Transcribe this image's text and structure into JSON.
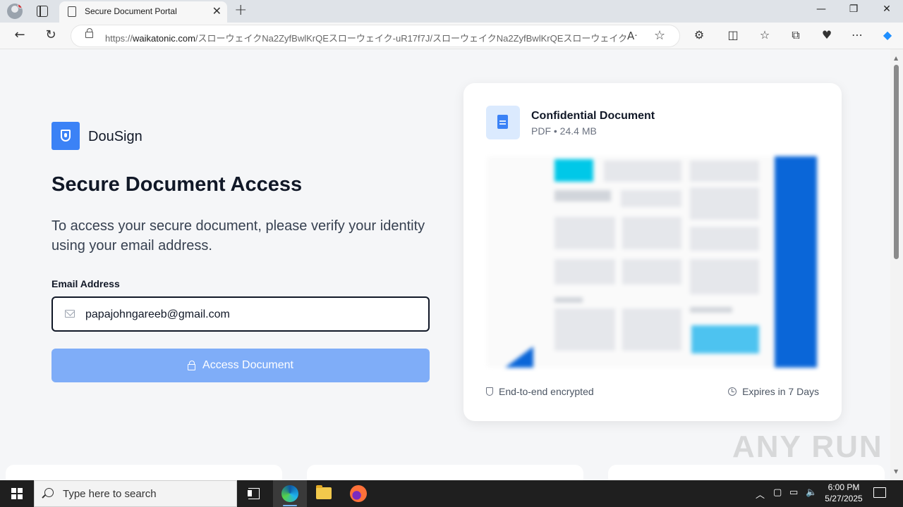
{
  "browser": {
    "tab_title": "Secure Document Portal",
    "url_prefix": "https://",
    "url_domain": "waikatonic.com",
    "url_path": "/スローウェイクNa2ZyfBwlKrQEスローウェイク-uR17f7J/スローウェイクNa2ZyfBwlKrQEスローウェイク-uR17f...",
    "new_tab_label": "+",
    "close_tab_label": "✕"
  },
  "brand": {
    "name": "DouSign",
    "accent": "#3b82f6"
  },
  "main": {
    "heading": "Secure Document Access",
    "description": "To access your secure document, please verify your identity using your email address.",
    "email_label": "Email Address",
    "email_value": "papajohngareeb@gmail.com",
    "button_label": "Access Document",
    "button_color": "#7fadf8"
  },
  "document": {
    "title": "Confidential Document",
    "meta": "PDF • 24.4 MB",
    "encryption_label": "End-to-end encrypted",
    "expiry_label": "Expires in 7 Days"
  },
  "watermark": "ANY RUN",
  "taskbar": {
    "search_placeholder": "Type here to search",
    "time": "6:00 PM",
    "date": "5/27/2025"
  }
}
